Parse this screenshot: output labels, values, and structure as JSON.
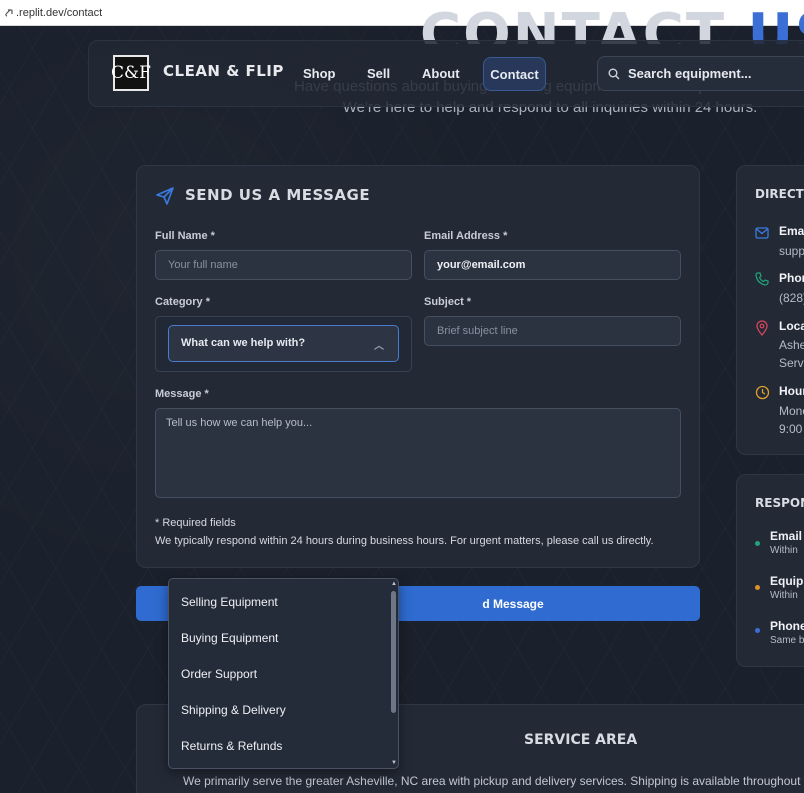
{
  "url": ".replit.dev/contact",
  "hero": {
    "title_part1": "CONTACT",
    "title_part2": "US",
    "subtitle": "Have questions about buying or selling equipment? Need help with an order? We're here to help and respond to all inquiries within 24 hours."
  },
  "header": {
    "logo_text": "C&F",
    "brand": "CLEAN & FLIP",
    "nav": [
      "Shop",
      "Sell",
      "About",
      "Contact"
    ],
    "search_placeholder": "Search equipment..."
  },
  "form": {
    "title": "SEND US A MESSAGE",
    "full_name_label": "Full Name *",
    "full_name_placeholder": "Your full name",
    "email_label": "Email Address *",
    "email_value": "your@email.com",
    "category_label": "Category *",
    "category_placeholder": "What can we help with?",
    "subject_label": "Subject *",
    "subject_placeholder": "Brief subject line",
    "message_label": "Message *",
    "message_placeholder": "Tell us how we can help you...",
    "required_note": "* Required fields",
    "response_note": "We typically respond within 24 hours during business hours. For urgent matters, please call us directly.",
    "submit_label": "d Message"
  },
  "dropdown": {
    "options": [
      "Selling Equipment",
      "Buying Equipment",
      "Order Support",
      "Shipping & Delivery",
      "Returns & Refunds"
    ]
  },
  "sidebar": {
    "direct_title": "DIRECT CO",
    "contacts": [
      {
        "label": "Emai",
        "value": "supp"
      },
      {
        "label": "Phor",
        "value": "(828)"
      },
      {
        "label": "Loca",
        "value": "Ashe",
        "value2": "Servi"
      },
      {
        "label": "Hour",
        "value": "Mono",
        "value2": "9:00"
      }
    ],
    "response_title": "RESPONSE",
    "responses": [
      {
        "label": "Email",
        "value": "Within",
        "color": "#22a37a"
      },
      {
        "label": "Equipr",
        "value": "Within",
        "color": "#e0902a"
      },
      {
        "label": "Phone",
        "value": "Same b",
        "color": "#3b6fd6"
      }
    ]
  },
  "service": {
    "title": "SERVICE AREA",
    "text": "We primarily serve the greater Asheville, NC area with pickup and delivery services. Shipping is available throughout th"
  }
}
